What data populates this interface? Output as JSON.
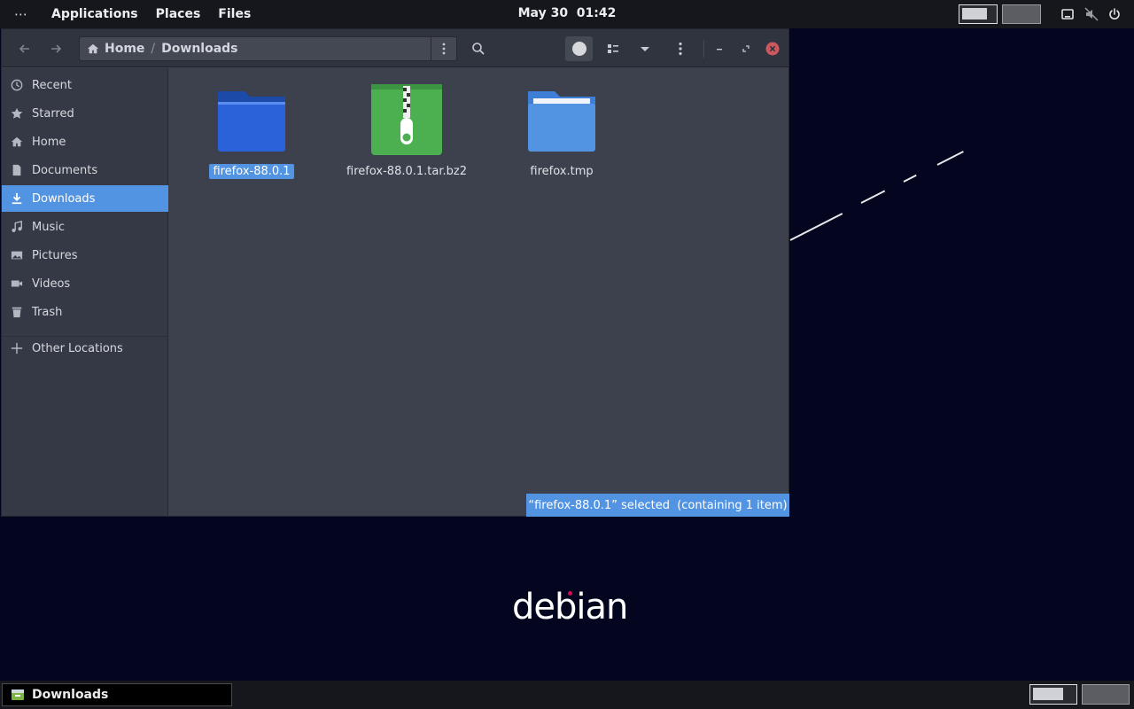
{
  "topbar": {
    "dots": "⋯",
    "menus": [
      "Applications",
      "Places",
      "Files"
    ],
    "clock": "May 30  01:42"
  },
  "window": {
    "path": [
      "Home",
      "Downloads"
    ],
    "path_separator": "/"
  },
  "sidebar": {
    "items": [
      {
        "label": "Recent",
        "icon": "clock-icon"
      },
      {
        "label": "Starred",
        "icon": "star-icon"
      },
      {
        "label": "Home",
        "icon": "home-icon"
      },
      {
        "label": "Documents",
        "icon": "document-icon"
      },
      {
        "label": "Downloads",
        "icon": "download-icon",
        "active": true
      },
      {
        "label": "Music",
        "icon": "music-icon"
      },
      {
        "label": "Pictures",
        "icon": "picture-icon"
      },
      {
        "label": "Videos",
        "icon": "video-icon"
      },
      {
        "label": "Trash",
        "icon": "trash-icon"
      }
    ],
    "other_locations": "Other Locations"
  },
  "files": [
    {
      "name": "firefox-88.0.1",
      "icon": "folder-icon",
      "selected": true
    },
    {
      "name": "firefox-88.0.1.tar.bz2",
      "icon": "archive-icon",
      "selected": false
    },
    {
      "name": "firefox.tmp",
      "icon": "folder-icon",
      "selected": false
    }
  ],
  "status": "“firefox-88.0.1” selected  (containing 1 item)",
  "desktop": {
    "logo_text": "debian"
  },
  "taskbar": {
    "task_label": "Downloads"
  },
  "colors": {
    "accent": "#5294e2",
    "desktop_bg": "#04061f",
    "panel_bg": "#16171d",
    "close_button": "#cc575d",
    "archive_green": "#4caf50",
    "debian_red": "#d70751"
  }
}
